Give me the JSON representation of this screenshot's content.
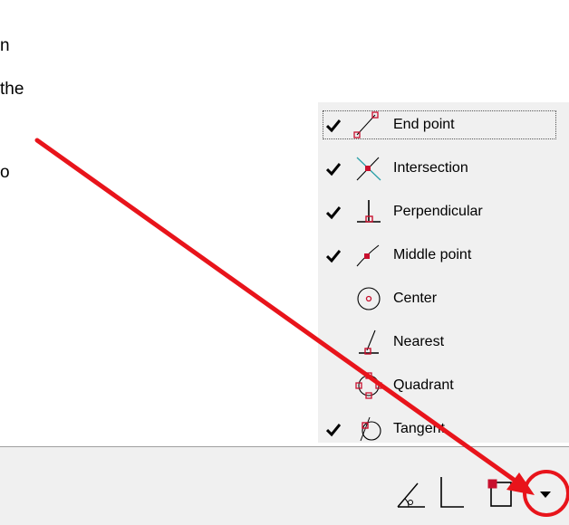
{
  "background_text": {
    "line1": "n",
    "line2": "the",
    "line3": "o"
  },
  "snap_menu": {
    "items": [
      {
        "label": "End point",
        "checked": true,
        "icon": "end-point-icon"
      },
      {
        "label": "Intersection",
        "checked": true,
        "icon": "intersection-icon"
      },
      {
        "label": "Perpendicular",
        "checked": true,
        "icon": "perpendicular-icon"
      },
      {
        "label": "Middle point",
        "checked": true,
        "icon": "middle-point-icon"
      },
      {
        "label": "Center",
        "checked": false,
        "icon": "center-icon"
      },
      {
        "label": "Nearest",
        "checked": false,
        "icon": "nearest-icon"
      },
      {
        "label": "Quadrant",
        "checked": false,
        "icon": "quadrant-icon"
      },
      {
        "label": "Tangent",
        "checked": true,
        "icon": "tangent-icon"
      }
    ]
  },
  "toolbar": {
    "icons": [
      "angle-snap-icon",
      "ortho-icon",
      "object-snap-icon",
      "dropdown-arrow-icon"
    ]
  },
  "annotations": {
    "arrow_color": "#e8141b",
    "circle_color": "#e8141b"
  },
  "colors": {
    "menu_bg": "#f0f0f0",
    "snap_marker": "#c8102e",
    "intersection_line": "#2aa0a8"
  }
}
